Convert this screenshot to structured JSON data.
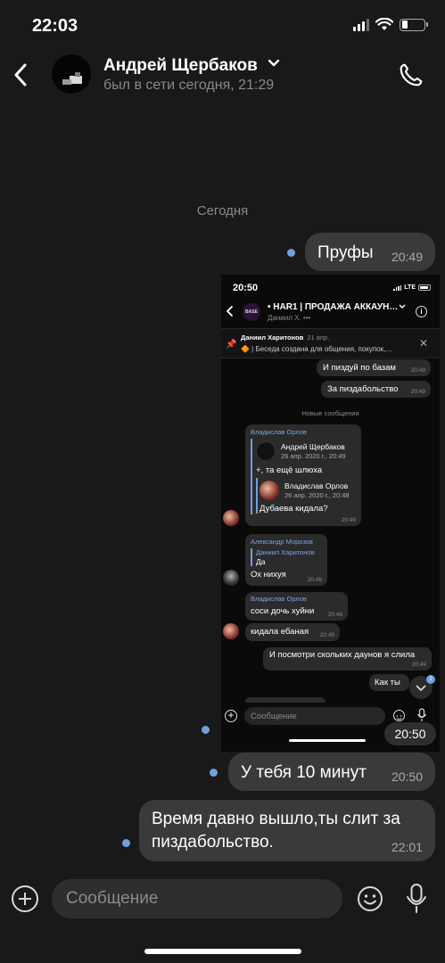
{
  "status_bar": {
    "time": "22:03"
  },
  "header": {
    "contact_name": "Андрей Щербаков",
    "contact_status": "был в сети сегодня, 21:29"
  },
  "date_separator": "Сегодня",
  "messages": [
    {
      "text": "Пруфы",
      "time": "20:49",
      "unread": true
    },
    {
      "text": "У тебя 10 минут",
      "time": "20:50",
      "unread": true
    },
    {
      "text": "Время давно вышло,ты слит за пиздабольство.",
      "time": "22:01",
      "unread": true
    }
  ],
  "screenshot_message": {
    "time": "20:50",
    "unread": true,
    "content": {
      "status_time": "20:50",
      "network": "LTE",
      "avatar_text": "BASE",
      "chat_title": "• HAR1 | ПРОДАЖА АККАУН…",
      "chat_subtitle": "Даниил Х. •••",
      "pinned": {
        "author": "Даниил Харитонов",
        "date": "21 апр.",
        "text": "🔶 | Беседа создана для общения, покупок,…"
      },
      "outgoing_top": [
        {
          "text": "И пиздуй по базам",
          "time": "20:49"
        },
        {
          "text": "За пиздабольство",
          "time": "20:49"
        }
      ],
      "new_messages_label": "Новые сообщения",
      "msg1": {
        "sender": "Владислав Орлов",
        "quote1_author": "Андрей Щербаков",
        "quote1_date": "26 апр. 2020 г., 20:49",
        "quote1_text": "+, та ещё шлюха",
        "quote2_author": "Владислав Орлов",
        "quote2_date": "26 апр. 2020 г., 20:48",
        "quote2_text": "Дубаева кидала?",
        "time": "20:49"
      },
      "msg2": {
        "sender": "Александр Морозов",
        "quote_author": "Даниил Харитонов",
        "quote_text": "Да",
        "text": "Ох нихуя",
        "time": "20:49"
      },
      "msg3": {
        "sender": "Владислав Орлов",
        "text": "соси дочь хуйни",
        "time": "20:49"
      },
      "msg4": {
        "text": "кидала ебаная",
        "time": "20:49"
      },
      "outgoing_bottom": {
        "text": "И посмотри скольких даунов я слила",
        "time": "20:49"
      },
      "partial": {
        "text": "Как ты"
      },
      "scroll_badge": "2",
      "composer_placeholder": "Сообщение"
    }
  },
  "composer": {
    "placeholder": "Сообщение"
  },
  "colors": {
    "background": "#191919",
    "bubble": "#3a3a3c",
    "unread_dot": "#6f9fe0",
    "secondary_text": "#8a8a8a"
  }
}
